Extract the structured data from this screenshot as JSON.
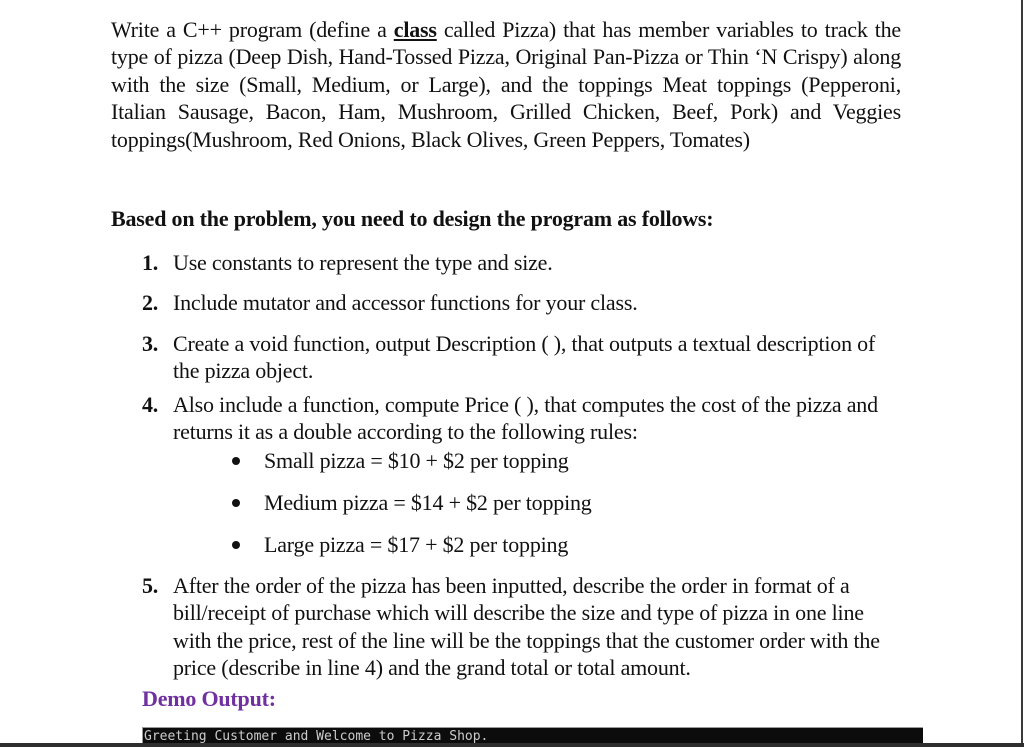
{
  "document": {
    "intro": {
      "before_class": "Write a C++ program (define a ",
      "class_word": "class",
      "after_class": " called Pizza) that has member variables to track the type of pizza (Deep Dish, Hand-Tossed Pizza, Original Pan-Pizza or Thin ‘N Crispy) along with the size (Small, Medium, or Large), and the toppings  Meat toppings (Pepperoni, Italian Sausage, Bacon, Ham, Mushroom, Grilled Chicken, Beef, Pork) and Veggies toppings(Mushroom, Red Onions, Black Olives, Green Peppers, Tomates)"
    },
    "design_heading": "Based on the problem, you need to design the program as follows:",
    "items": [
      {
        "num": "1.",
        "text": "Use constants to represent the type and size."
      },
      {
        "num": "2.",
        "text": "Include mutator and accessor functions for your class."
      },
      {
        "num": "3.",
        "text": "Create a void function, output Description ( ), that outputs a textual description of the pizza object."
      },
      {
        "num": "4.",
        "text": "Also include a function, compute Price ( ), that computes the cost of the pizza and returns it as a double according to the following rules:"
      },
      {
        "num": "5.",
        "text": "After the order of the pizza has been inputted, describe the order in format of a bill/receipt of purchase which will describe the size and type of pizza in one line with the price, rest of the line will be the toppings that the customer order with the price (describe in line 4) and the grand total or total amount."
      }
    ],
    "price_rules": [
      "Small pizza = $10 + $2 per topping",
      "Medium pizza = $14 + $2 per topping",
      "Large pizza = $17 + $2 per topping"
    ],
    "demo_heading": "Demo Output:",
    "console": {
      "lines": [
        "Greeting Customer and Welcome to Pizza Shop."
      ]
    }
  },
  "colors": {
    "demo_heading": "#7030a0",
    "console_background": "#0c0c0c",
    "console_text": "#cccccc"
  }
}
